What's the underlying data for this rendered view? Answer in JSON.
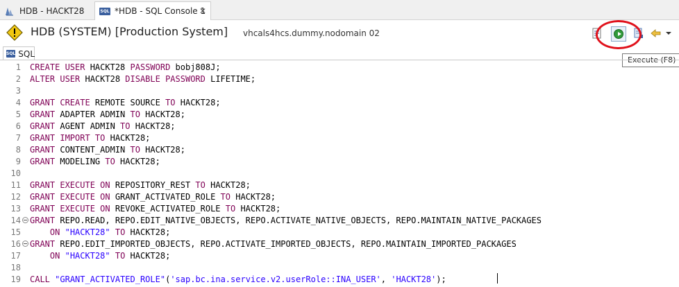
{
  "tabs": [
    {
      "label": "HDB - HACKT28",
      "icon": "hdb-system-icon",
      "active": false
    },
    {
      "label": "*HDB - SQL Console 1",
      "icon": "sql-console-icon",
      "active": true,
      "close": "✕"
    }
  ],
  "header": {
    "title": "HDB (SYSTEM) [Production System]",
    "host": "vhcals4hcs.dummy.nodomain 02"
  },
  "toolbar": {
    "tooltip": "Execute (F8)"
  },
  "subtab": {
    "label": "SQL"
  },
  "colors": {
    "keyword": "#7f0055",
    "string": "#2a00ff",
    "highlight": "#e0111b"
  },
  "code_lines": [
    {
      "n": "1",
      "segs": [
        [
          "kw",
          "CREATE USER"
        ],
        [
          "t",
          " HACKT28 "
        ],
        [
          "kw",
          "PASSWORD"
        ],
        [
          "t",
          " bobj808J;"
        ]
      ]
    },
    {
      "n": "2",
      "segs": [
        [
          "kw",
          "ALTER USER"
        ],
        [
          "t",
          " HACKT28 "
        ],
        [
          "kw",
          "DISABLE PASSWORD"
        ],
        [
          "t",
          " LIFETIME;"
        ]
      ]
    },
    {
      "n": "3",
      "segs": []
    },
    {
      "n": "4",
      "segs": [
        [
          "kw",
          "GRANT CREATE"
        ],
        [
          "t",
          " REMOTE SOURCE "
        ],
        [
          "kw",
          "TO"
        ],
        [
          "t",
          " HACKT28;"
        ]
      ]
    },
    {
      "n": "5",
      "segs": [
        [
          "kw",
          "GRANT"
        ],
        [
          "t",
          " ADAPTER ADMIN "
        ],
        [
          "kw",
          "TO"
        ],
        [
          "t",
          " HACKT28;"
        ]
      ]
    },
    {
      "n": "6",
      "segs": [
        [
          "kw",
          "GRANT"
        ],
        [
          "t",
          " AGENT ADMIN "
        ],
        [
          "kw",
          "TO"
        ],
        [
          "t",
          " HACKT28;"
        ]
      ]
    },
    {
      "n": "7",
      "segs": [
        [
          "kw",
          "GRANT IMPORT TO"
        ],
        [
          "t",
          " HACKT28;"
        ]
      ]
    },
    {
      "n": "8",
      "segs": [
        [
          "kw",
          "GRANT"
        ],
        [
          "t",
          " CONTENT_ADMIN "
        ],
        [
          "kw",
          "TO"
        ],
        [
          "t",
          " HACKT28;"
        ]
      ]
    },
    {
      "n": "9",
      "segs": [
        [
          "kw",
          "GRANT"
        ],
        [
          "t",
          " MODELING "
        ],
        [
          "kw",
          "TO"
        ],
        [
          "t",
          " HACKT28;"
        ]
      ]
    },
    {
      "n": "10",
      "segs": []
    },
    {
      "n": "11",
      "segs": [
        [
          "kw",
          "GRANT EXECUTE ON"
        ],
        [
          "t",
          " REPOSITORY_REST "
        ],
        [
          "kw",
          "TO"
        ],
        [
          "t",
          " HACKT28;"
        ]
      ]
    },
    {
      "n": "12",
      "segs": [
        [
          "kw",
          "GRANT EXECUTE ON"
        ],
        [
          "t",
          " GRANT_ACTIVATED_ROLE "
        ],
        [
          "kw",
          "TO"
        ],
        [
          "t",
          " HACKT28;"
        ]
      ]
    },
    {
      "n": "13",
      "segs": [
        [
          "kw",
          "GRANT EXECUTE ON"
        ],
        [
          "t",
          " REVOKE_ACTIVATED_ROLE "
        ],
        [
          "kw",
          "TO"
        ],
        [
          "t",
          " HACKT28;"
        ]
      ]
    },
    {
      "n": "14",
      "fold": true,
      "segs": [
        [
          "kw",
          "GRANT"
        ],
        [
          "t",
          " REPO.READ, REPO.EDIT_NATIVE_OBJECTS, REPO.ACTIVATE_NATIVE_OBJECTS, REPO.MAINTAIN_NATIVE_PACKAGES"
        ]
      ]
    },
    {
      "n": "15",
      "segs": [
        [
          "t",
          "    "
        ],
        [
          "kw",
          "ON"
        ],
        [
          "t",
          " "
        ],
        [
          "str",
          "\"HACKT28\""
        ],
        [
          "t",
          " "
        ],
        [
          "kw",
          "TO"
        ],
        [
          "t",
          " HACKT28;"
        ]
      ]
    },
    {
      "n": "16",
      "fold": true,
      "segs": [
        [
          "kw",
          "GRANT"
        ],
        [
          "t",
          " REPO.EDIT_IMPORTED_OBJECTS, REPO.ACTIVATE_IMPORTED_OBJECTS, REPO.MAINTAIN_IMPORTED_PACKAGES"
        ]
      ]
    },
    {
      "n": "17",
      "segs": [
        [
          "t",
          "    "
        ],
        [
          "kw",
          "ON"
        ],
        [
          "t",
          " "
        ],
        [
          "str",
          "\"HACKT28\""
        ],
        [
          "t",
          " "
        ],
        [
          "kw",
          "TO"
        ],
        [
          "t",
          " HACKT28;"
        ]
      ]
    },
    {
      "n": "18",
      "segs": []
    },
    {
      "n": "19",
      "segs": [
        [
          "kw",
          "CALL"
        ],
        [
          "t",
          " "
        ],
        [
          "str",
          "\"GRANT_ACTIVATED_ROLE\""
        ],
        [
          "t",
          "("
        ],
        [
          "str",
          "'sap.bc.ina.service.v2.userRole::INA_USER'"
        ],
        [
          "t",
          ", "
        ],
        [
          "str",
          "'HACKT28'"
        ],
        [
          "t",
          ");"
        ]
      ]
    }
  ]
}
